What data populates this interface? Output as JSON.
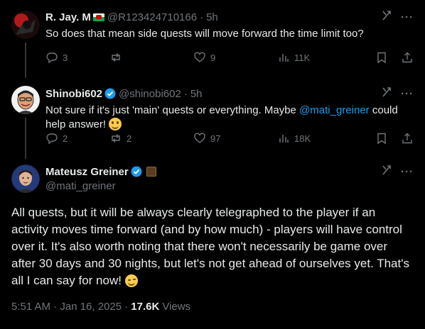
{
  "replies": [
    {
      "name": "R. Jay. M",
      "handle": "@R123424710166",
      "time": "5h",
      "text": "So does that mean side quests will move forward the time limit too?",
      "reply_count": "3",
      "retweet_count": "",
      "like_count": "9",
      "view_count": "11K"
    },
    {
      "name": "Shinobi602",
      "handle": "@shinobi602",
      "time": "5h",
      "text_before": "Not sure if it's just 'main' quests or everything. Maybe ",
      "mention": "@mati_greiner",
      "text_after": " could help answer! ",
      "reply_count": "2",
      "retweet_count": "2",
      "like_count": "97",
      "view_count": "18K"
    }
  ],
  "main_post": {
    "name": "Mateusz Greiner",
    "handle": "@mati_greiner",
    "text": "All quests, but it will be always clearly telegraphed to the player if an activity moves time forward (and by how much) - players will have control over it. It's also worth noting that there won't necessarily be game over after 30 days and 30 nights, but let's not get ahead of ourselves yet. That's all I can say for now! ",
    "timestamp": "5:51 AM · Jan 16, 2025 ·",
    "view_count": "17.6K",
    "views_label": "Views"
  },
  "colors": {
    "background": "#000000",
    "text": "#e7e9ea",
    "muted": "#71767b",
    "accent": "#1d9bf0",
    "divider": "#333639"
  },
  "icons": [
    "grok-icon",
    "more-icon",
    "reply-icon",
    "retweet-icon",
    "like-icon",
    "views-icon",
    "bookmark-icon",
    "share-icon",
    "verified-badge-icon",
    "wales-flag-icon",
    "smile-emoji-icon",
    "wink-emoji-icon"
  ]
}
